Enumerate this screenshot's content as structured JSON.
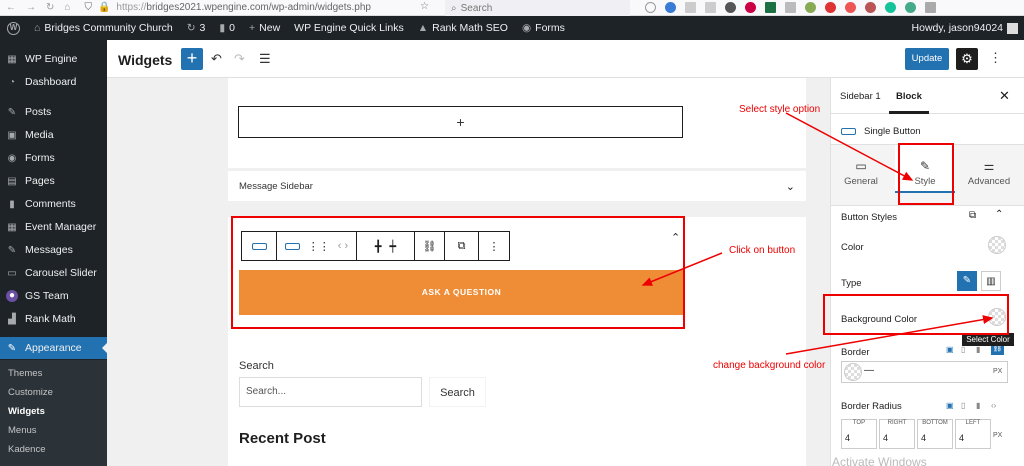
{
  "browser": {
    "url_prefix": "https://",
    "url": "bridges2021.wpengine.com/wp-admin/widgets.php",
    "search_placeholder": "Search"
  },
  "adminbar": {
    "wp_logo": "W",
    "site_name": "Bridges Community Church",
    "updates": "3",
    "comments": "0",
    "new_label": "New",
    "quick_links": "WP Engine Quick Links",
    "rank_math": "Rank Math SEO",
    "forms": "Forms",
    "howdy": "Howdy, jason94024"
  },
  "sidebar": {
    "items": [
      {
        "icon": "wpengine-icon",
        "label": "WP Engine"
      },
      {
        "icon": "dashboard-icon",
        "label": "Dashboard"
      },
      {
        "icon": "pin-icon",
        "label": "Posts"
      },
      {
        "icon": "media-icon",
        "label": "Media"
      },
      {
        "icon": "forms-icon",
        "label": "Forms"
      },
      {
        "icon": "pages-icon",
        "label": "Pages"
      },
      {
        "icon": "comments-icon",
        "label": "Comments"
      },
      {
        "icon": "calendar-icon",
        "label": "Event Manager"
      },
      {
        "icon": "pin-icon",
        "label": "Messages"
      },
      {
        "icon": "slider-icon",
        "label": "Carousel Slider"
      },
      {
        "icon": "team-icon",
        "label": "GS Team"
      },
      {
        "icon": "chart-icon",
        "label": "Rank Math"
      },
      {
        "icon": "brush-icon",
        "label": "Appearance"
      }
    ],
    "sub_items": [
      "Themes",
      "Customize",
      "Widgets",
      "Menus",
      "Kadence"
    ]
  },
  "editor": {
    "title": "Widgets",
    "update_label": "Update"
  },
  "canvas": {
    "add_block": "+",
    "message_sidebar": "Message Sidebar",
    "ask_button": "ASK A QUESTION",
    "search_label": "Search",
    "search_placeholder": "Search...",
    "search_button": "Search",
    "recent_post": "Recent Post"
  },
  "inspector": {
    "tab_sidebar": "Sidebar 1",
    "tab_block": "Block",
    "block_name": "Single Button",
    "style_tabs": [
      "General",
      "Style",
      "Advanced"
    ],
    "button_styles": "Button Styles",
    "color_label": "Color",
    "type_label": "Type",
    "bg_label": "Background Color",
    "tooltip": "Select Color",
    "border_label": "Border",
    "border_unit": "PX",
    "radius_label": "Border Radius",
    "radius_cells": [
      {
        "label": "TOP",
        "value": "4"
      },
      {
        "label": "RIGHT",
        "value": "4"
      },
      {
        "label": "BOTTOM",
        "value": "4"
      },
      {
        "label": "LEFT",
        "value": "4"
      }
    ],
    "radius_unit": "PX",
    "watermark": "Activate Windows"
  },
  "annotations": {
    "select_style": "Select style  option",
    "click_button": "Click on button",
    "change_bg": "change background color"
  },
  "colors": {
    "admin_dark": "#1d2327",
    "accent_blue": "#2271b1",
    "button_orange": "#ef8d36",
    "annotation_red": "#e00000"
  }
}
